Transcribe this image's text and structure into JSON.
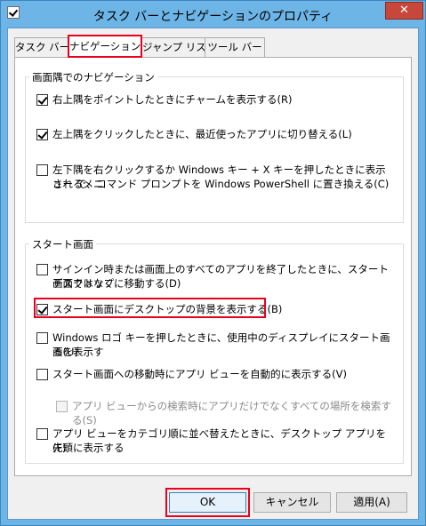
{
  "window": {
    "title": "タスク バーとナビゲーションのプロパティ",
    "close_label": "✕"
  },
  "tabs": [
    {
      "label": "タスク バー",
      "active": false
    },
    {
      "label": "ナビゲーション",
      "active": true
    },
    {
      "label": "ジャンプ リスト",
      "active": false
    },
    {
      "label": "ツール バー",
      "active": false
    }
  ],
  "corner_nav": {
    "title": "画面隅でのナビゲーション",
    "options": [
      {
        "lines": [
          "右上隅をポイントしたときにチャームを表示する(R)"
        ],
        "checked": true
      },
      {
        "lines": [
          "左上隅をクリックしたときに、最近使ったアプリに切り替える(L)"
        ],
        "checked": true
      },
      {
        "lines": [
          "左下隅を右クリックするか Windows キー + X キーを押したときに表示されるメニ",
          "ュー で、コマンド プロンプトを Windows PowerShell に置き換える(C)"
        ],
        "checked": false
      }
    ]
  },
  "start_screen": {
    "title": "スタート画面",
    "options": [
      {
        "lines": [
          "サインイン時または画面上のすべてのアプリを終了したときに、スタート画面ではなく",
          "デスクトップに移動する(D)"
        ],
        "checked": false,
        "disabled": false
      },
      {
        "lines": [
          "スタート画面にデスクトップの背景を表示する(B)"
        ],
        "checked": true,
        "disabled": false
      },
      {
        "lines": [
          "Windows ロゴ キーを押したときに、使用中のディスプレイにスタート画面を表示す",
          "る(U)"
        ],
        "checked": false,
        "disabled": false
      },
      {
        "lines": [
          "スタート画面への移動時にアプリ ビューを自動的に表示する(V)"
        ],
        "checked": false,
        "disabled": false
      },
      {
        "lines": [
          "アプリ ビューからの検索時にアプリだけでなくすべての場所を検索する(S)"
        ],
        "checked": false,
        "disabled": true
      },
      {
        "lines": [
          "アプリ ビューをカテゴリ順に並べ替えたときに、デスクトップ アプリを先頭に表示する",
          "(F)"
        ],
        "checked": false,
        "disabled": false
      }
    ]
  },
  "buttons": {
    "ok": "OK",
    "cancel": "キャンセル",
    "apply": "適用(A)"
  },
  "colors": {
    "highlight": "#e8001c",
    "frame": "#6cb5e6",
    "close": "#c7483a"
  }
}
